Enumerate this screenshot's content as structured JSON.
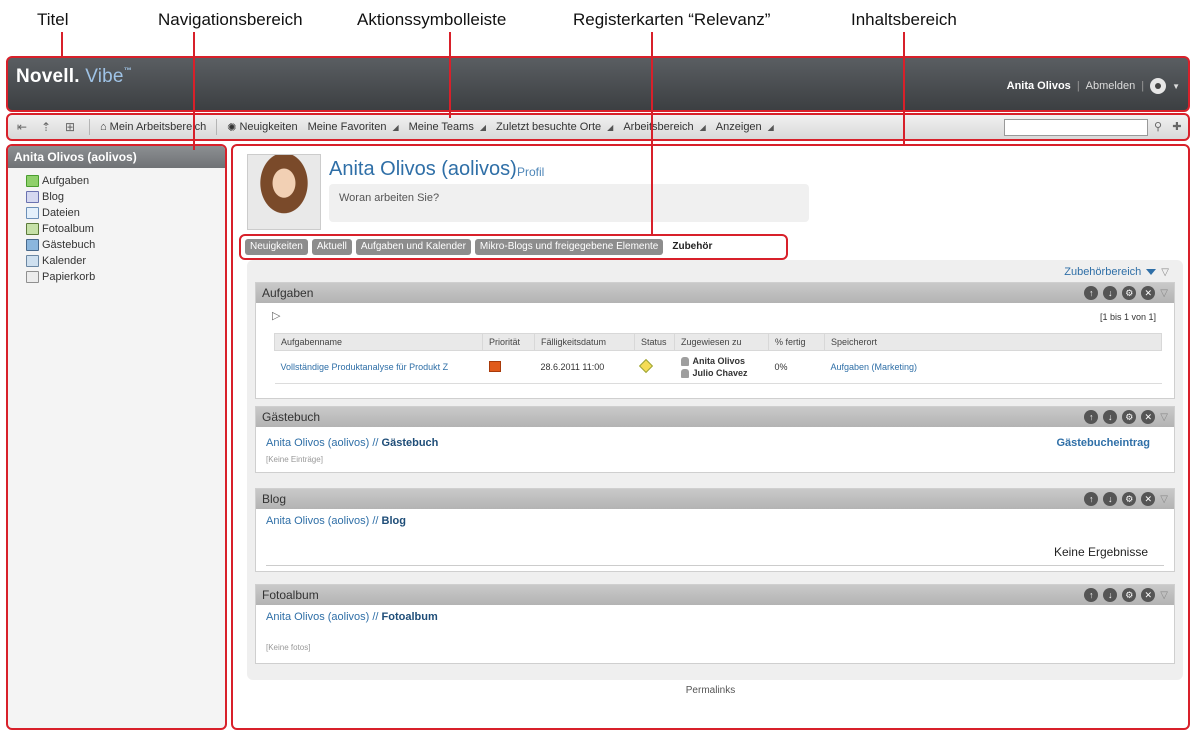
{
  "callouts": [
    {
      "label": "Titel"
    },
    {
      "label": "Navigationsbereich"
    },
    {
      "label": "Aktionssymbolleiste"
    },
    {
      "label": "Registerkarten “Relevanz”"
    },
    {
      "label": "Inhaltsbereich"
    }
  ],
  "header": {
    "logo_brand": "Novell.",
    "logo_product": "Vibe",
    "logo_tm": "™",
    "user_name": "Anita Olivos",
    "separator": "|",
    "logout": "Abmelden"
  },
  "toolbar": {
    "items": [
      {
        "label": "Mein Arbeitsbereich"
      },
      {
        "label": "Neuigkeiten"
      },
      {
        "label": "Meine Favoriten"
      },
      {
        "label": "Meine Teams"
      },
      {
        "label": "Zuletzt besuchte Orte"
      },
      {
        "label": "Arbeitsbereich"
      },
      {
        "label": "Anzeigen"
      }
    ],
    "search_value": ""
  },
  "sidebar": {
    "title": "Anita Olivos (aolivos)",
    "items": [
      {
        "label": "Aufgaben"
      },
      {
        "label": "Blog"
      },
      {
        "label": "Dateien"
      },
      {
        "label": "Fotoalbum"
      },
      {
        "label": "Gästebuch"
      },
      {
        "label": "Kalender"
      },
      {
        "label": "Papierkorb"
      }
    ]
  },
  "profile": {
    "name": "Anita Olivos (aolivos)",
    "profile_link": "Profil",
    "status_prompt": "Woran arbeiten Sie?"
  },
  "tabs": [
    {
      "label": "Neuigkeiten"
    },
    {
      "label": "Aktuell"
    },
    {
      "label": "Aufgaben und Kalender"
    },
    {
      "label": "Mikro-Blogs und freigegebene Elemente"
    },
    {
      "label": "Zubehör"
    }
  ],
  "accessories": {
    "area_label": "Zubehörbereich",
    "tasks": {
      "title": "Aufgaben",
      "paging": "[1 bis 1 von 1]",
      "columns": [
        "Aufgabenname",
        "Priorität",
        "Fälligkeitsdatum",
        "Status",
        "Zugewiesen zu",
        "% fertig",
        "Speicherort"
      ],
      "rows": [
        {
          "name": "Vollständige Produktanalyse für Produkt Z",
          "due": "28.6.2011 11:00",
          "assignees": [
            "Anita Olivos",
            "Julio Chavez"
          ],
          "percent": "0%",
          "location": "Aufgaben (Marketing)"
        }
      ]
    },
    "guestbook": {
      "title": "Gästebuch",
      "crumb_prefix": "Anita Olivos (aolivos) //",
      "crumb_name": "Gästebuch",
      "empty": "[Keine Einträge]",
      "action": "Gästebucheintrag"
    },
    "blog": {
      "title": "Blog",
      "crumb_prefix": "Anita Olivos (aolivos) //",
      "crumb_name": "Blog",
      "empty": "Keine Ergebnisse"
    },
    "photo": {
      "title": "Fotoalbum",
      "crumb_prefix": "Anita Olivos (aolivos) //",
      "crumb_name": "Fotoalbum",
      "empty": "[Keine fotos]"
    }
  },
  "footer": {
    "permalinks": "Permalinks"
  },
  "colors": {
    "highlight": "#d8202a",
    "link": "#2f6fa7",
    "header_bg": "#4a4d50"
  }
}
